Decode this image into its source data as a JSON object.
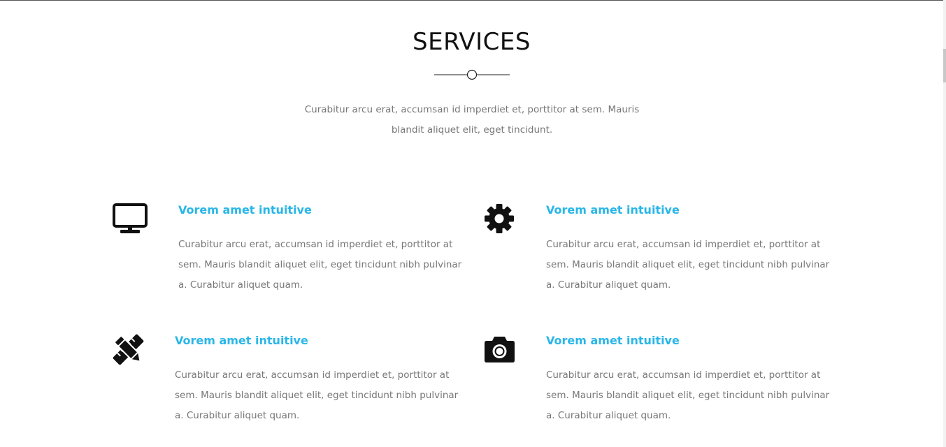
{
  "section": {
    "title": "SERVICES",
    "intro": "Curabitur arcu erat, accumsan id imperdiet et, porttitor at sem. Mauris blandit aliquet elit, eget tincidunt."
  },
  "services": [
    {
      "icon": "desktop-icon",
      "heading": "Vorem amet intuitive",
      "text": "Curabitur arcu erat, accumsan id imperdiet et, porttitor at sem. Mauris blandit aliquet elit, eget tincidunt nibh pulvinar a. Curabitur aliquet quam."
    },
    {
      "icon": "gear-icon",
      "heading": "Vorem amet intuitive",
      "text": "Curabitur arcu erat, accumsan id imperdiet et, porttitor at sem. Mauris blandit aliquet elit, eget tincidunt nibh pulvinar a. Curabitur aliquet quam."
    },
    {
      "icon": "pencil-ruler-icon",
      "heading": "Vorem amet intuitive",
      "text": "Curabitur arcu erat, accumsan id imperdiet et, porttitor at sem. Mauris blandit aliquet elit, eget tincidunt nibh pulvinar a. Curabitur aliquet quam."
    },
    {
      "icon": "camera-icon",
      "heading": "Vorem amet intuitive",
      "text": "Curabitur arcu erat, accumsan id imperdiet et, porttitor at sem. Mauris blandit aliquet elit, eget tincidunt nibh pulvinar a. Curabitur aliquet quam."
    }
  ],
  "colors": {
    "accent": "#29b6e8",
    "body_text": "#777777",
    "title": "#111111",
    "icon": "#111111"
  }
}
